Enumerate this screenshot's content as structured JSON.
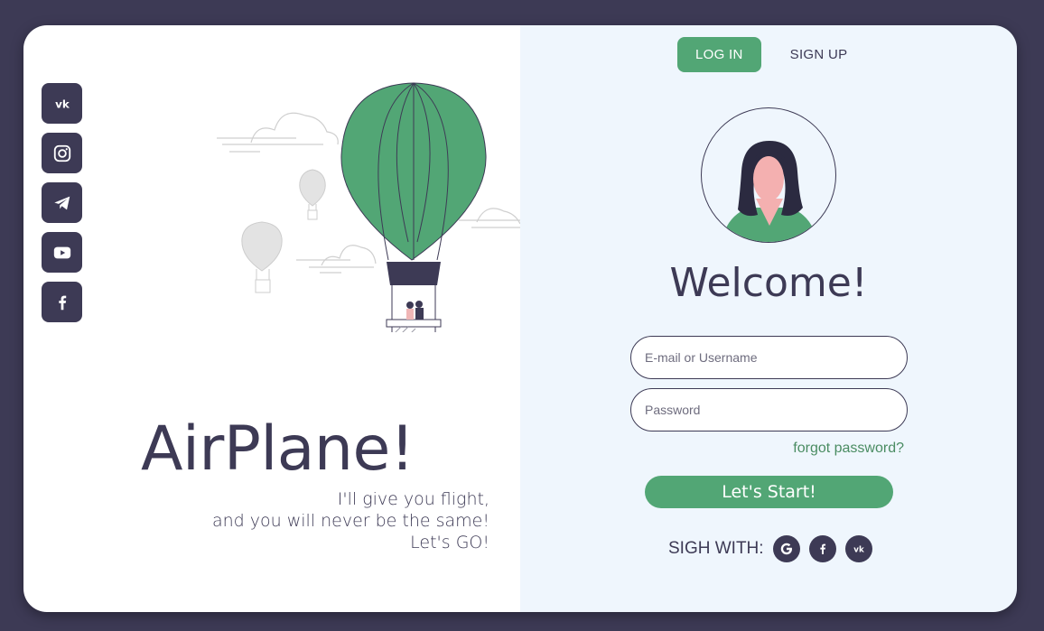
{
  "brand": {
    "title": "AirPlane!",
    "tagline": [
      "I'll give you flight,",
      "and you will never be the same!",
      "Let's GO!"
    ]
  },
  "social_sidebar": [
    "vk-icon",
    "instagram-icon",
    "telegram-icon",
    "youtube-icon",
    "facebook-icon"
  ],
  "tabs": [
    {
      "label": "LOG IN",
      "active": true
    },
    {
      "label": "SIGN UP",
      "active": false
    }
  ],
  "form": {
    "welcome": "Welcome!",
    "email_placeholder": "E-mail or Username",
    "email_value": "",
    "password_placeholder": "Password",
    "password_value": "",
    "forgot_label": "forgot password?",
    "submit_label": "Let's Start!"
  },
  "sign_with": {
    "label": "SIGH WITH:",
    "providers": [
      "google-icon",
      "facebook-icon",
      "vk-icon"
    ]
  },
  "colors": {
    "background": "#3d3a55",
    "accent": "#52a675",
    "panel_right": "#eff6fd",
    "text": "#3d3a55"
  }
}
